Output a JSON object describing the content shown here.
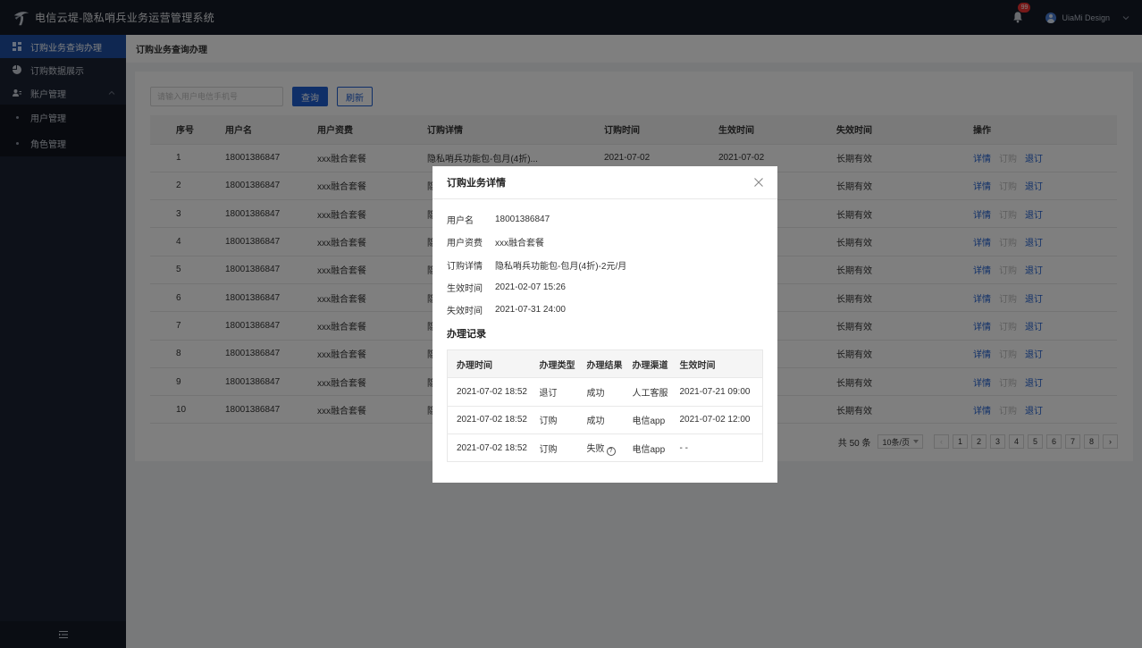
{
  "app": {
    "title": "电信云堤-隐私哨兵业务运营管理系统",
    "notification_count": "99",
    "user_name": "UiaMi Design"
  },
  "sidebar": {
    "items": [
      {
        "label": "订购业务查询办理",
        "icon": "dashboard-icon"
      },
      {
        "label": "订购数据展示",
        "icon": "pie-chart-icon"
      },
      {
        "label": "账户管理",
        "icon": "users-icon"
      }
    ],
    "subitems": [
      {
        "label": "用户管理"
      },
      {
        "label": "角色管理"
      }
    ],
    "collapse_icon": "menu-fold-icon"
  },
  "page": {
    "title": "订购业务查询办理"
  },
  "search": {
    "placeholder": "请输入用户电信手机号",
    "value": "",
    "query_label": "查询",
    "refresh_label": "刷新"
  },
  "table": {
    "columns": [
      "序号",
      "用户名",
      "用户资费",
      "订购详情",
      "订购时间",
      "生效时间",
      "失效时间",
      "操作"
    ],
    "rows": [
      {
        "no": "1",
        "user": "18001386847",
        "plan": "xxx融合套餐",
        "detail": "隐私哨兵功能包-包月(4折)...",
        "order_time": "2021-07-02",
        "effective": "2021-07-02",
        "expire": "长期有效"
      },
      {
        "no": "2",
        "user": "18001386847",
        "plan": "xxx融合套餐",
        "detail": "隐",
        "order_time": "",
        "effective": "",
        "expire": "长期有效"
      },
      {
        "no": "3",
        "user": "18001386847",
        "plan": "xxx融合套餐",
        "detail": "隐",
        "order_time": "",
        "effective": "",
        "expire": "长期有效"
      },
      {
        "no": "4",
        "user": "18001386847",
        "plan": "xxx融合套餐",
        "detail": "隐",
        "order_time": "",
        "effective": "",
        "expire": "长期有效"
      },
      {
        "no": "5",
        "user": "18001386847",
        "plan": "xxx融合套餐",
        "detail": "隐",
        "order_time": "",
        "effective": "",
        "expire": "长期有效"
      },
      {
        "no": "6",
        "user": "18001386847",
        "plan": "xxx融合套餐",
        "detail": "隐",
        "order_time": "",
        "effective": "",
        "expire": "长期有效"
      },
      {
        "no": "7",
        "user": "18001386847",
        "plan": "xxx融合套餐",
        "detail": "隐",
        "order_time": "",
        "effective": "",
        "expire": "长期有效"
      },
      {
        "no": "8",
        "user": "18001386847",
        "plan": "xxx融合套餐",
        "detail": "隐",
        "order_time": "",
        "effective": "",
        "expire": "长期有效"
      },
      {
        "no": "9",
        "user": "18001386847",
        "plan": "xxx融合套餐",
        "detail": "隐",
        "order_time": "",
        "effective": "",
        "expire": "长期有效"
      },
      {
        "no": "10",
        "user": "18001386847",
        "plan": "xxx融合套餐",
        "detail": "隐",
        "order_time": "",
        "effective": "",
        "expire": "长期有效"
      }
    ],
    "actions": {
      "detail": "详情",
      "order": "订购",
      "unsubscribe": "退订"
    }
  },
  "pagination": {
    "total": "共 50 条",
    "page_size": "10条/页",
    "pages": [
      "1",
      "2",
      "3",
      "4",
      "5",
      "6",
      "7",
      "8"
    ],
    "prev": "‹",
    "next": "›"
  },
  "modal": {
    "title": "订购业务详情",
    "fields": [
      {
        "label": "用户名",
        "value": "18001386847"
      },
      {
        "label": "用户资费",
        "value": "xxx融合套餐"
      },
      {
        "label": "订购详情",
        "value": "隐私哨兵功能包-包月(4折)-2元/月"
      },
      {
        "label": "生效时间",
        "value": "2021-02-07 15:26"
      },
      {
        "label": "失效时间",
        "value": "2021-07-31 24:00"
      }
    ],
    "records_title": "办理记录",
    "records_columns": [
      "办理时间",
      "办理类型",
      "办理结果",
      "办理渠道",
      "生效时间"
    ],
    "records": [
      {
        "time": "2021-07-02 18:52",
        "type": "退订",
        "result": "成功",
        "channel": "人工客服",
        "effective": "2021-07-21 09:00"
      },
      {
        "time": "2021-07-02 18:52",
        "type": "订购",
        "result": "成功",
        "channel": "电信app",
        "effective": "2021-07-02 12:00"
      },
      {
        "time": "2021-07-02 18:52",
        "type": "订购",
        "result": "失败",
        "channel": "电信app",
        "effective": "- -"
      }
    ]
  },
  "colors": {
    "accent": "#1f5fd1",
    "topbar": "#141a26",
    "sidebar": "#1a2232",
    "sidebar_active": "#1f4fa3"
  }
}
